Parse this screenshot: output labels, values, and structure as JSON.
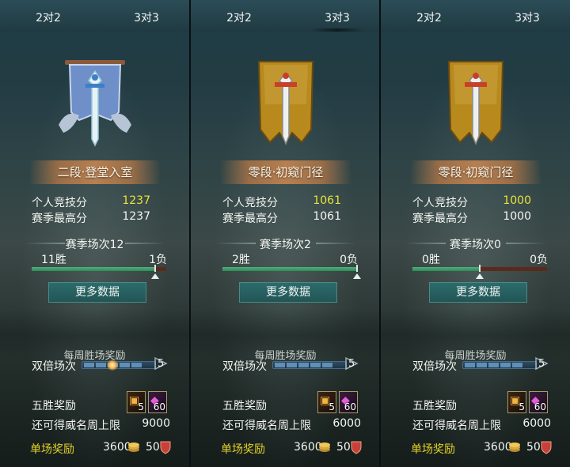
{
  "tabs": {
    "tab_2v2": "2对2",
    "tab_3v3": "3对3"
  },
  "labels": {
    "personal_score": "个人竞技分",
    "season_best": "赛季最高分",
    "more_data": "更多数据",
    "weekly_reward": "每周胜场奖励",
    "double_matches": "双倍场次",
    "five_win_reward": "五胜奖励",
    "fame_limit": "还可得威名周上限",
    "single_reward": "单场奖励"
  },
  "icons": {
    "five_win_item_1": "gold-chest-icon",
    "five_win_item_2": "purple-token-icon",
    "currency": "coin-stack-icon",
    "fame": "red-shield-icon",
    "rank_emblem_silver": "silver-sword-banner-emblem",
    "rank_emblem_gold": "bronze-sword-banner-emblem"
  },
  "colors": {
    "highlight_score": "#e8e23a",
    "single_reward_label": "#e3d227",
    "win_bar": "#2e8a58",
    "loss_bar": "#5a2a1c"
  },
  "panels": [
    {
      "rank": "二段·登堂入室",
      "personal_score": "1237",
      "season_best": "1237",
      "season_matches": "赛季场次12",
      "wins": "11胜",
      "losses": "1负",
      "win_ratio": 0.917,
      "double_count": "5",
      "double_progress": 0.4,
      "five_win_count": "5",
      "token_count": "60",
      "fame_limit_value": "9000",
      "single_reward_currency": "3600",
      "single_reward_fame": "50"
    },
    {
      "rank": "零段·初窥门径",
      "personal_score": "1061",
      "season_best": "1061",
      "season_matches": "赛季场次2",
      "wins": "2胜",
      "losses": "0负",
      "win_ratio": 1.0,
      "double_count": "5",
      "double_progress": 0.0,
      "five_win_count": "5",
      "token_count": "60",
      "fame_limit_value": "6000",
      "single_reward_currency": "3600",
      "single_reward_fame": "50"
    },
    {
      "rank": "零段·初窥门径",
      "personal_score": "1000",
      "season_best": "1000",
      "season_matches": "赛季场次0",
      "wins": "0胜",
      "losses": "0负",
      "win_ratio": 0.5,
      "double_count": "5",
      "double_progress": 0.0,
      "five_win_count": "5",
      "token_count": "60",
      "fame_limit_value": "6000",
      "single_reward_currency": "3600",
      "single_reward_fame": "50"
    }
  ]
}
